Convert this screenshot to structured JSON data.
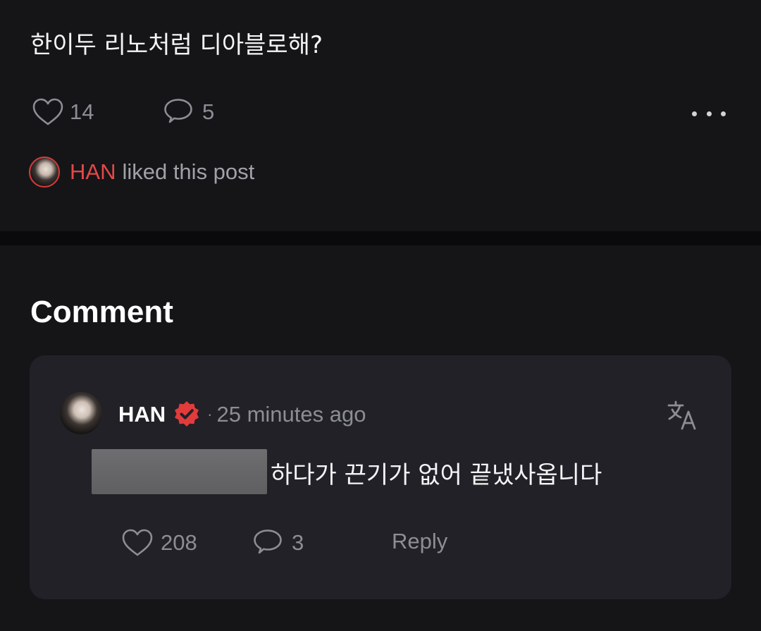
{
  "post": {
    "text": "한이두 리노처럼 디아블로해?",
    "likes": "14",
    "comments": "5",
    "liked_by": {
      "name": "HAN",
      "text": "liked this post"
    }
  },
  "comments_section": {
    "title": "Comment",
    "items": [
      {
        "author": "HAN",
        "verified": true,
        "separator": "·",
        "timestamp": "25 minutes ago",
        "text": "하다가 끈기가 없어 끝냈사옵니다",
        "likes": "208",
        "replies": "3",
        "reply_label": "Reply"
      }
    ]
  },
  "icons": {
    "like": "heart-outline-icon",
    "comment": "speech-bubble-icon",
    "more": "more-horizontal-icon",
    "verified": "verified-badge-icon",
    "translate": "translate-icon"
  },
  "colors": {
    "background": "#151518",
    "card": "#212127",
    "accent": "#e44848",
    "muted": "#8d8d95"
  }
}
